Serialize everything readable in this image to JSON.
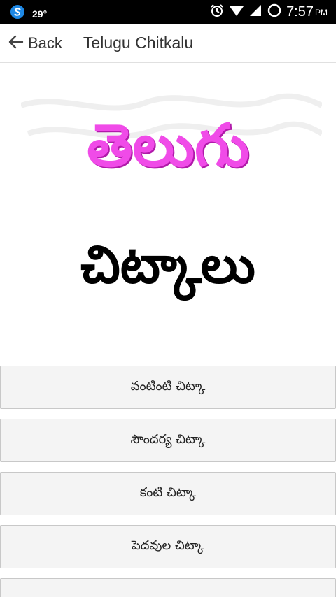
{
  "status_bar": {
    "temperature": "29°",
    "time": "7:57",
    "ampm": "PM"
  },
  "app_bar": {
    "back_label": "Back",
    "title": "Telugu Chitkalu"
  },
  "banner": {
    "title_line1": "తెలుగు",
    "title_line2": "చిట్కాలు"
  },
  "menu": {
    "items": [
      {
        "label": "వంటింటి చిట్కా"
      },
      {
        "label": "సౌందర్య చిట్కా"
      },
      {
        "label": "కంటి చిట్కా"
      },
      {
        "label": "పెదవుల చిట్కా"
      },
      {
        "label": ""
      }
    ]
  },
  "colors": {
    "accent_pink": "#f04be8",
    "status_bar": "#000000"
  },
  "icons": {
    "status_app": "s-logo-icon",
    "alarm": "alarm-clock-icon",
    "wifi": "wifi-icon",
    "signal": "signal-icon",
    "battery": "battery-ring-icon",
    "back": "arrow-left-icon"
  }
}
